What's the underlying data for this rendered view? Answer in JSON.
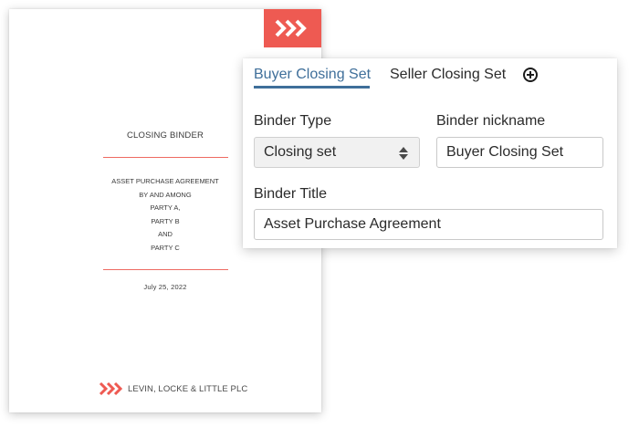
{
  "document": {
    "title": "CLOSING BINDER",
    "lines": [
      "ASSET PURCHASE AGREEMENT",
      "BY AND AMONG",
      "PARTY A,",
      "PARTY B",
      "AND",
      "PARTY C"
    ],
    "date": "July 25, 2022",
    "firm_name": "LEVIN, LOCKE & LITTLE PLC",
    "logo_icon": "chevrons-right-icon",
    "accent_color": "#ee5a52"
  },
  "tabs": [
    {
      "label": "Buyer Closing Set",
      "active": true
    },
    {
      "label": "Seller Closing Set",
      "active": false
    }
  ],
  "add_tab_icon": "plus-circle-icon",
  "form": {
    "binder_type_label": "Binder Type",
    "binder_type_value": "Closing set",
    "binder_nickname_label": "Binder nickname",
    "binder_nickname_value": "Buyer Closing Set",
    "binder_title_label": "Binder Title",
    "binder_title_value": "Asset Purchase Agreement"
  },
  "colors": {
    "active_tab": "#3f6f9a",
    "brand": "#ee5a52"
  }
}
